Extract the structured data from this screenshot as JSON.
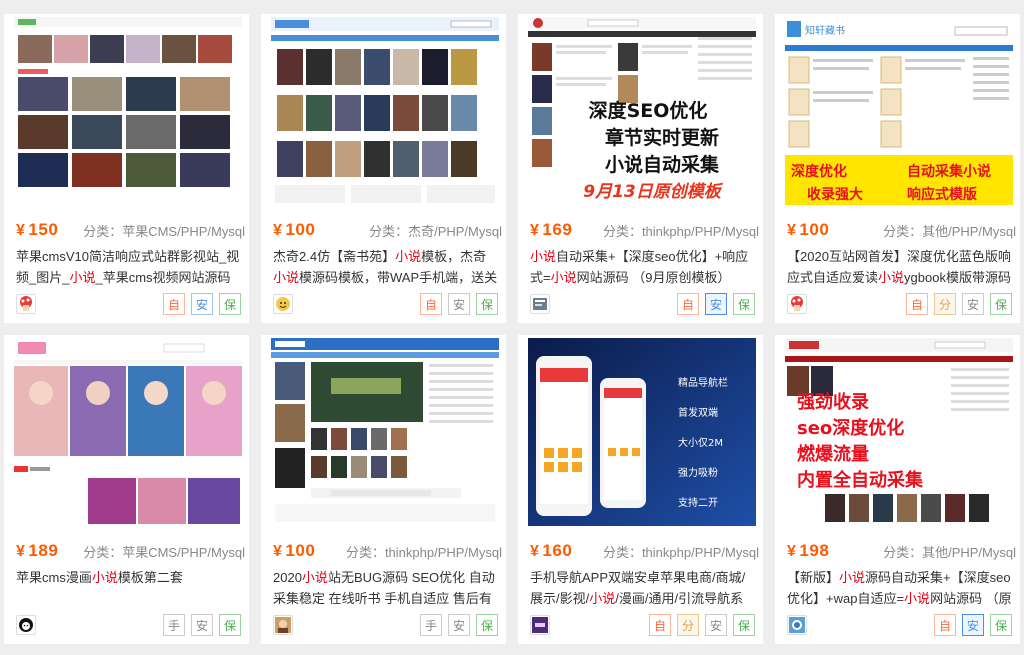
{
  "cards": [
    {
      "price": "150",
      "currency": "¥",
      "category": "分类：苹果CMS/PHP/Mysql",
      "title_parts": [
        "苹果cmsV10简洁响应式站群影视站_视频_图片_",
        "小说",
        "_苹果cms视频网站源码模"
      ],
      "avatar_icon": "mushroom-avatar-icon",
      "badges": [
        "自",
        "安",
        "保"
      ]
    },
    {
      "price": "100",
      "currency": "¥",
      "category": "分类：杰奇/PHP/Mysql",
      "title_parts": [
        "杰奇2.4仿【斋书苑】",
        "小说",
        "模板，杰奇",
        "小说",
        "模源码模板，带WAP手机端，送关关"
      ],
      "avatar_icon": "cartoon-face-avatar-icon",
      "badges": [
        "自",
        "安",
        "保"
      ]
    },
    {
      "price": "169",
      "currency": "¥",
      "category": "分类：thinkphp/PHP/Mysql",
      "title_parts": [
        "",
        "小说",
        "自动采集+【深度seo优化】+响应式=",
        "小说",
        "网站源码 （9月原创模板）"
      ],
      "thumb_lines": [
        "深度SEO优化",
        "章节实时更新",
        "小说自动采集",
        "9月13日原创模板"
      ],
      "avatar_icon": "book-avatar-icon",
      "badges": [
        "自",
        "安",
        "保"
      ]
    },
    {
      "price": "100",
      "currency": "¥",
      "category": "分类：其他/PHP/Mysql",
      "title_parts": [
        "【2020互站网首发】深度优化蓝色版响应式自适应爱读",
        "小说",
        "ygbook模版带源码"
      ],
      "thumb_lines": [
        "知轩藏书",
        "深度优化",
        "自动采集小说",
        "收录强大",
        "响应式模版"
      ],
      "avatar_icon": "mushroom-avatar-icon",
      "badges": [
        "自",
        "分",
        "安",
        "保"
      ]
    },
    {
      "price": "189",
      "currency": "¥",
      "category": "分类：苹果CMS/PHP/Mysql",
      "title_parts": [
        "苹果cms漫画",
        "小说",
        "模板第二套"
      ],
      "avatar_icon": "cat-avatar-icon",
      "badges": [
        "手",
        "安",
        "保"
      ]
    },
    {
      "price": "100",
      "currency": "¥",
      "category": "分类：thinkphp/PHP/Mysql",
      "title_parts": [
        "2020",
        "小说",
        "站无BUG源码 SEO优化 自动采集稳定 在线听书 手机自适应 售后有保"
      ],
      "avatar_icon": "character-avatar-icon",
      "badges": [
        "手",
        "安",
        "保"
      ]
    },
    {
      "price": "160",
      "currency": "¥",
      "category": "分类：thinkphp/PHP/Mysql",
      "title_parts": [
        "手机导航APP双端安卓苹果电商/商城/展示/影视/",
        "小说",
        "/漫画/通用/引流导航系统"
      ],
      "thumb_lines": [
        "精品导航栏",
        "首发双端",
        "大小仅2M",
        "强力吸粉",
        "支持二开"
      ],
      "avatar_icon": "logo-avatar-icon",
      "badges": [
        "自",
        "分",
        "安",
        "保"
      ]
    },
    {
      "price": "198",
      "currency": "¥",
      "category": "分类：其他/PHP/Mysql",
      "title_parts": [
        "【新版】",
        "小说",
        "源码自动采集+【深度seo优化】+wap自适应=",
        "小说",
        "网站源码 （原"
      ],
      "thumb_lines": [
        "强劲收录",
        "seo深度优化",
        "燃爆流量",
        "内置全自动采集"
      ],
      "avatar_icon": "globe-avatar-icon",
      "badges": [
        "自",
        "安",
        "保"
      ]
    }
  ],
  "colors": {
    "price": "#ff5a00",
    "highlight": "#e60012",
    "badge_zi": "#ff6a3d",
    "badge_an": "#4a90e2",
    "badge_bao": "#4caf50"
  }
}
